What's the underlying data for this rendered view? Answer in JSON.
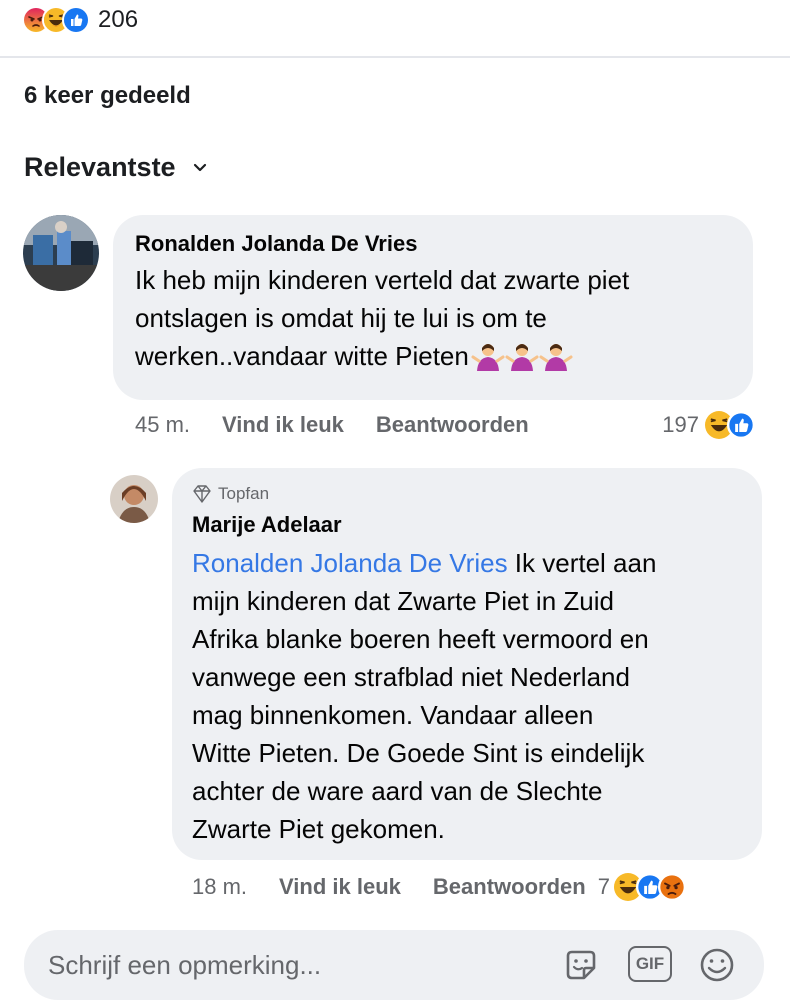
{
  "reactions": {
    "count": "206",
    "icons": [
      "angry-reaction-icon",
      "haha-reaction-icon",
      "like-reaction-icon"
    ]
  },
  "shares": "6 keer gedeeld",
  "sort": {
    "label": "Relevantste"
  },
  "comment1": {
    "author": "Ronalden Jolanda De Vries",
    "lines": [
      "Ik heb mijn kinderen verteld dat zwarte piet",
      "ontslagen is omdat hij te lui is om te",
      "werken..vandaar witte Pieten"
    ],
    "emoji_trail": [
      "person-shrugging-emoji",
      "person-shrugging-emoji",
      "person-shrugging-emoji"
    ],
    "time": "45 m.",
    "like_label": "Vind ik leuk",
    "reply_label": "Beantwoorden",
    "reaction_count": "197",
    "reaction_icons": [
      "haha-reaction-icon",
      "like-reaction-icon"
    ]
  },
  "comment2": {
    "badge": "Topfan",
    "author": "Marije Adelaar",
    "mention": "Ronalden Jolanda De Vries",
    "first_line_rest": " Ik vertel aan",
    "lines": [
      "mijn kinderen dat Zwarte Piet in Zuid",
      "Afrika blanke boeren heeft vermoord en",
      "vanwege een strafblad niet Nederland",
      "mag binnenkomen. Vandaar alleen",
      "Witte Pieten. De Goede Sint is eindelijk",
      "achter de ware aard van de Slechte",
      "Zwarte Piet gekomen."
    ],
    "time": "18 m.",
    "like_label": "Vind ik leuk",
    "reply_label": "Beantwoorden",
    "reaction_count": "7",
    "reaction_icons": [
      "haha-reaction-icon",
      "like-reaction-icon",
      "angry-reaction-icon"
    ]
  },
  "composer": {
    "placeholder": "Schrijf een opmerking...",
    "gif_label": "GIF"
  },
  "colors": {
    "like_blue": "#1877f2",
    "haha_yellow": "#f7b928",
    "angry_orange": "#e9710f",
    "mention_blue": "#3578e5",
    "bubble_gray": "#eef0f3"
  }
}
